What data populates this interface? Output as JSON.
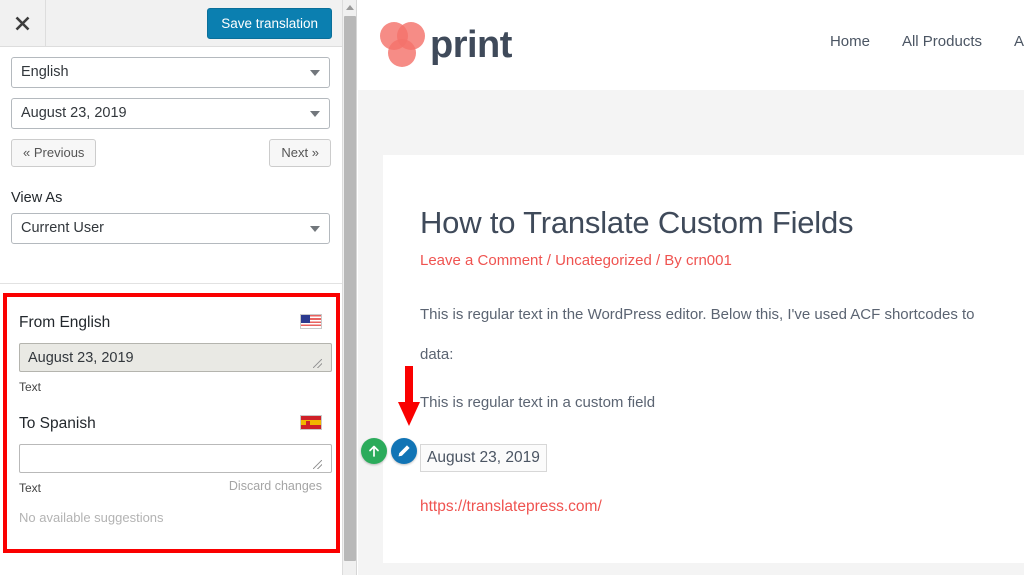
{
  "sidebar": {
    "close_label": "close-icon",
    "save_label": "Save translation",
    "language_select": {
      "value": "English",
      "caret": "chevron-down-icon"
    },
    "string_select": {
      "value": "August 23, 2019",
      "caret": "chevron-down-icon"
    },
    "prev_label": "« Previous",
    "next_label": "Next »",
    "view_as_label": "View As",
    "view_as_select": {
      "value": "Current User",
      "caret": "chevron-down-icon"
    },
    "card": {
      "from_title": "From English",
      "from_flag": "us-flag-icon",
      "from_value": "August 23, 2019",
      "from_type": "Text",
      "to_title": "To Spanish",
      "to_flag": "es-flag-icon",
      "to_value": "",
      "to_placeholder": "",
      "to_type": "Text",
      "discard_label": "Discard changes",
      "suggestions": "No available suggestions",
      "highlight_color": "#fa0000"
    }
  },
  "site": {
    "logo_text": "print",
    "logo_color": "#f4736b",
    "nav": [
      {
        "label": "Home"
      },
      {
        "label": "All Products"
      },
      {
        "label": "A"
      }
    ],
    "post": {
      "title": "How to Translate Custom Fields",
      "meta": "Leave a Comment / Uncategorized / By crn001",
      "meta_color": "#ef5350",
      "paragraph_1": "This is regular text in the WordPress editor. Below this, I've used ACF shortcodes to",
      "paragraph_1b": "data:",
      "paragraph_2": "This is regular text in a custom field",
      "acf_value": "August 23, 2019",
      "link": "https://translatepress.com/",
      "link_color": "#ef5350"
    },
    "overlay": {
      "arrow_color": "#fa0000",
      "scroll_top_icon": "arrow-up-icon",
      "edit_icon": "pencil-icon",
      "green": "#2bab5b",
      "blue": "#1174b5"
    }
  }
}
